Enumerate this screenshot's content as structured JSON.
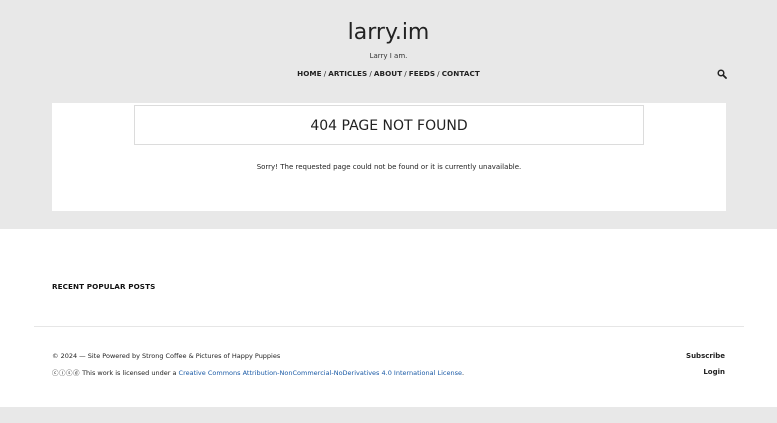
{
  "header": {
    "site_title": "larry.im",
    "tagline": "Larry I am."
  },
  "nav": {
    "items": [
      {
        "label": "HOME"
      },
      {
        "label": "ARTICLES"
      },
      {
        "label": "ABOUT"
      },
      {
        "label": "FEEDS"
      },
      {
        "label": "CONTACT"
      }
    ],
    "separator": "/"
  },
  "main": {
    "heading": "404 PAGE NOT FOUND",
    "message": "Sorry! The requested page could not be found or it is currently unavailable."
  },
  "sidebar": {
    "recent_heading": "RECENT POPULAR POSTS"
  },
  "footer": {
    "copyright": "© 2024 — Site Powered by Strong Coffee & Pictures of Happy Puppies",
    "cc_icons": "ⓒⓘⓢⓓ",
    "license_prefix": "This work is licensed under a",
    "license_link": "Creative Commons Attribution-NonCommercial-NoDerivatives 4.0 International License",
    "license_suffix": ".",
    "subscribe": "Subscribe",
    "login": "Login"
  },
  "icons": {
    "search": "search-icon"
  },
  "colors": {
    "background": "#e8e8e8",
    "card": "#ffffff",
    "link": "#1a5aa6",
    "text": "#222222"
  }
}
